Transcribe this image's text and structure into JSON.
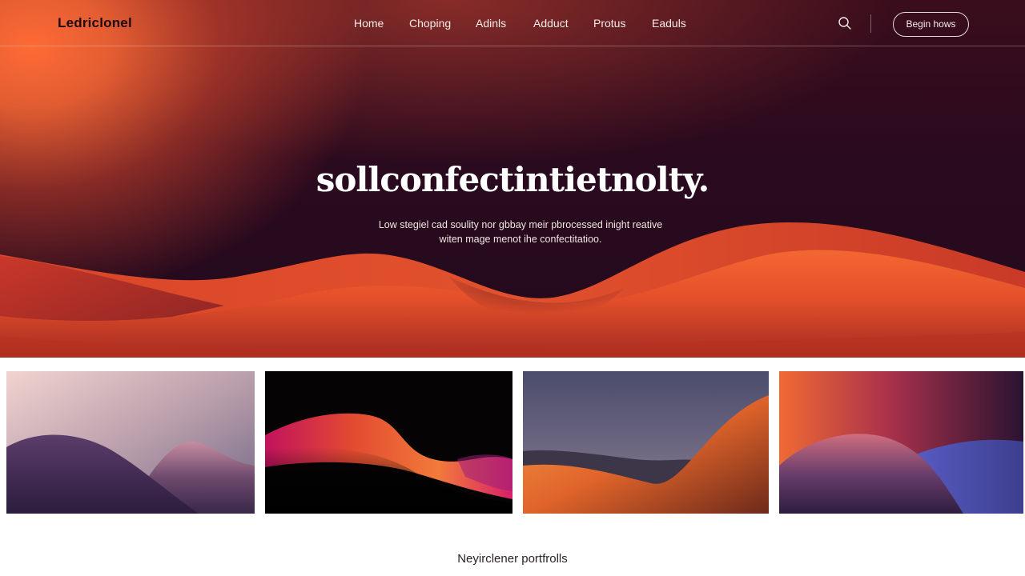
{
  "brand": {
    "logo": "Ledriclonel"
  },
  "nav": {
    "links": [
      "Home",
      "Choping",
      "Adinls",
      "Adduct",
      "Protus",
      "Eaduls"
    ],
    "search_icon": "search-icon",
    "cta_label": "Begin hows"
  },
  "hero": {
    "title": "sollconfectintietnolty.",
    "subtitle_line1": "Low stegiel cad soulity nor gbbay meir pbrocessed inight reative",
    "subtitle_line2": "witen mage menot ihe confectitatioo."
  },
  "gallery": {
    "cards": [
      {
        "name": "dusk-hills"
      },
      {
        "name": "crimson-wave"
      },
      {
        "name": "amber-dune"
      },
      {
        "name": "violet-sunset"
      }
    ]
  },
  "section": {
    "caption": "Neyirclener portfrolls"
  },
  "colors": {
    "accent": "#ff6a35",
    "hero_dark": "#23091c",
    "wave_orange": "#f0572c",
    "text_light": "#f6ece8"
  }
}
